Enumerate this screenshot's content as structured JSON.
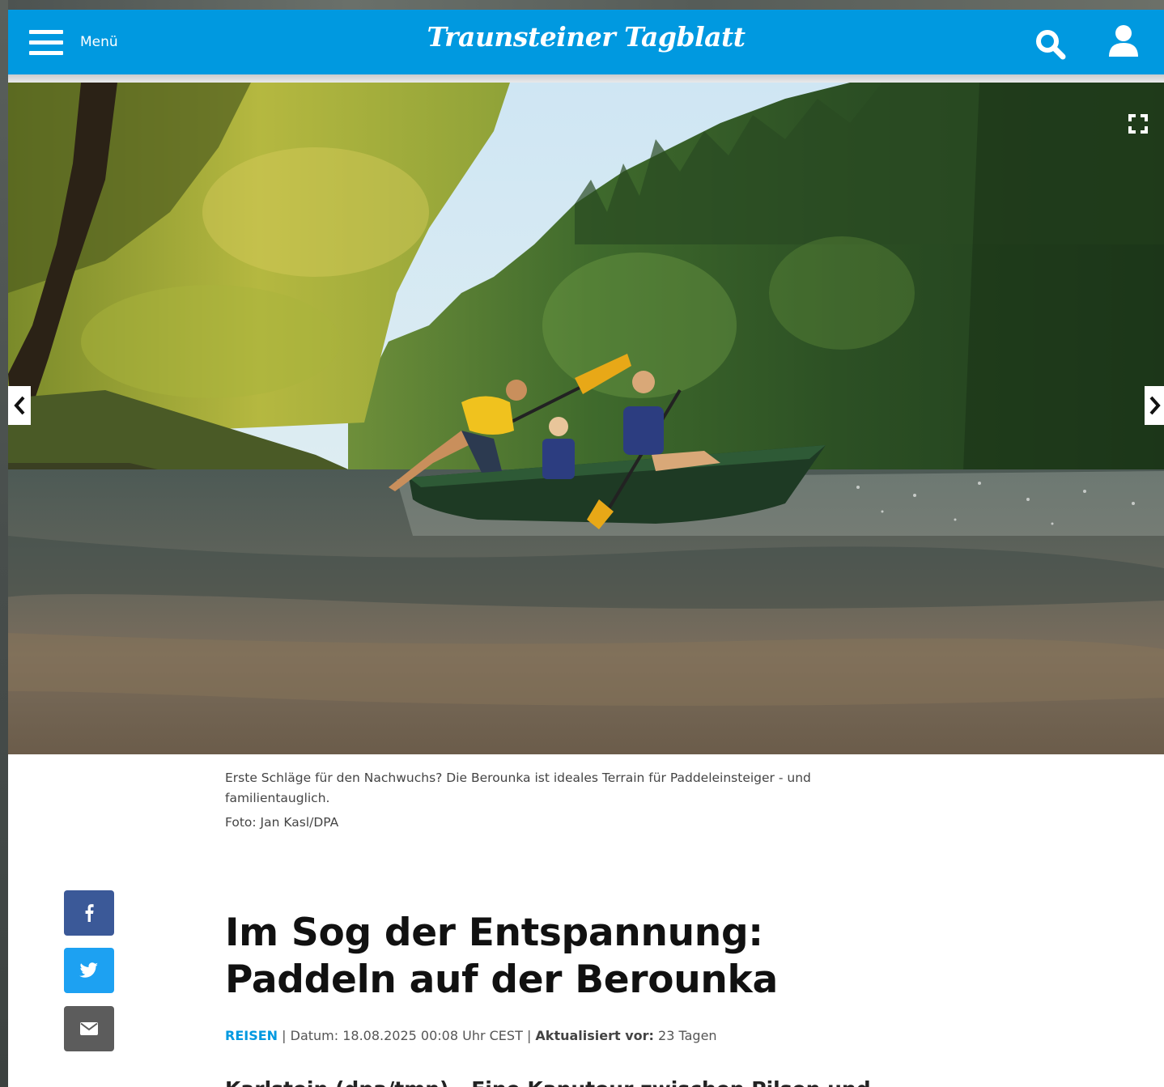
{
  "header": {
    "menu_label": "Menü",
    "logo_text": "Traunsteiner Tagblatt",
    "brand_color": "#0099e0",
    "icons": [
      "menu-icon",
      "search-icon",
      "user-icon"
    ]
  },
  "hero": {
    "icons": [
      "fullscreen-icon",
      "chevron-left-icon",
      "chevron-right-icon"
    ]
  },
  "caption": {
    "text": "Erste Schläge für den Nachwuchs? Die Berounka ist ideales Terrain für Paddeleinsteiger - und familientauglich.",
    "credit": "Foto: Jan Kasl/DPA"
  },
  "share": {
    "icons": [
      "facebook-icon",
      "twitter-icon",
      "email-icon"
    ]
  },
  "article": {
    "title": "Im Sog der Entspannung: Paddeln auf der Berounka",
    "category": "REISEN",
    "date_text": "Datum: 18.08.2025 00:08 Uhr CEST",
    "updated_label": "Aktualisiert vor:",
    "updated_value": "23 Tagen",
    "lead": "Karlstein (dpa/tmn) - Eine Kanutour zwischen Pilsen und"
  }
}
